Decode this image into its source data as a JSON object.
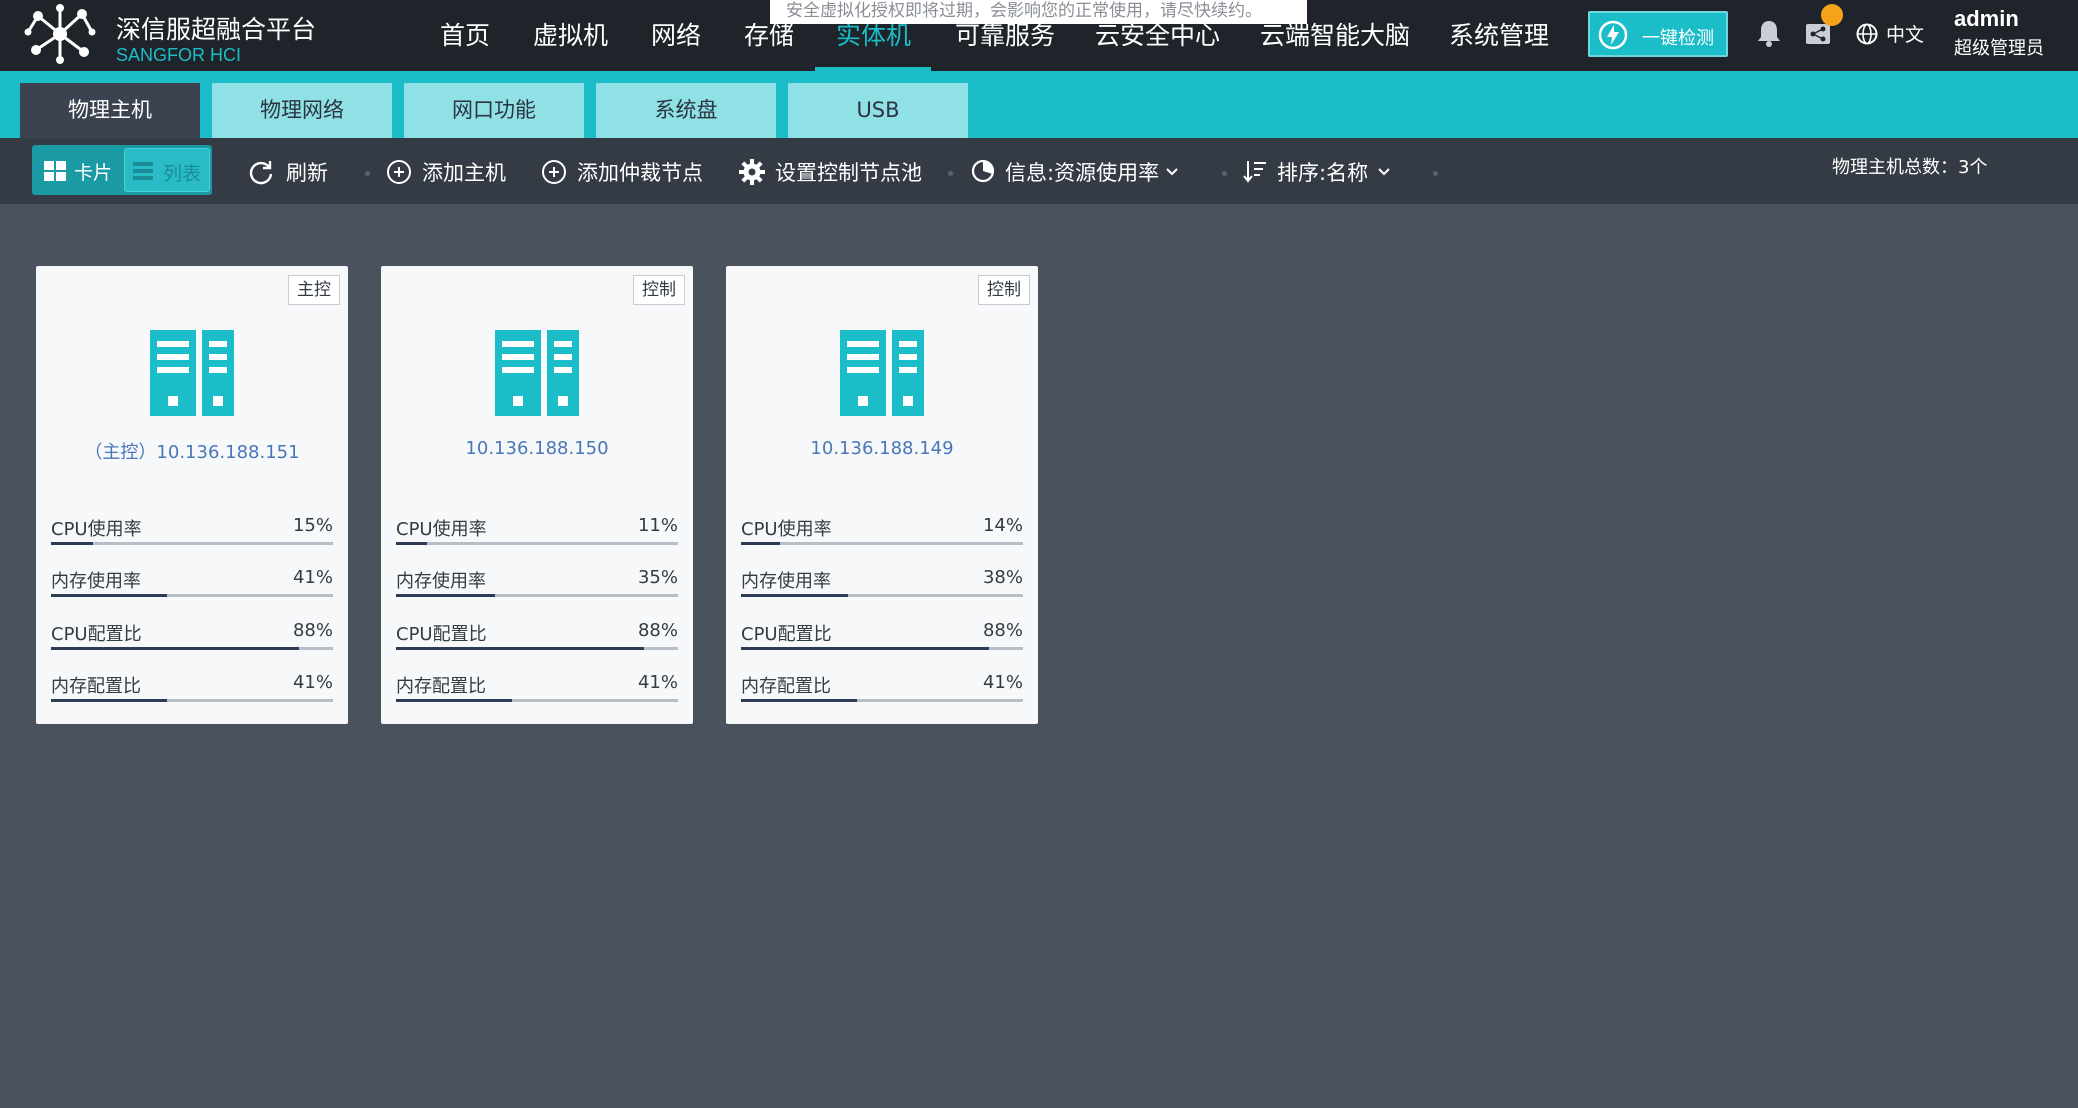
{
  "header": {
    "brand_cn": "深信服超融合平台",
    "brand_en": "SANGFOR HCI",
    "notice": "安全虚拟化授权即将过期，会影响您的正常使用，请尽快续约。",
    "nav": [
      "首页",
      "虚拟机",
      "网络",
      "存储",
      "实体机",
      "可靠服务",
      "云安全中心",
      "云端智能大脑",
      "系统管理"
    ],
    "active_nav_index": 4,
    "detect_button": "一键检测",
    "language": "中文",
    "user": {
      "name": "admin",
      "role": "超级管理员"
    },
    "badge_color": "#f7a21b"
  },
  "tabs": [
    "物理主机",
    "物理网络",
    "网口功能",
    "系统盘",
    "USB"
  ],
  "active_tab_index": 0,
  "toolbar": {
    "view_card": "卡片",
    "view_list": "列表",
    "refresh": "刷新",
    "add_host": "添加主机",
    "add_arbiter": "添加仲裁节点",
    "set_control_pool": "设置控制节点池",
    "info": "信息:资源使用率",
    "sort": "排序:名称",
    "total": "物理主机总数：3个"
  },
  "colors": {
    "accent": "#1bbec8",
    "header_bg": "#1f242b",
    "page_bg": "#4a525d",
    "link": "#4a76b8"
  },
  "hosts": [
    {
      "tag": "主控",
      "name": "（主控）10.136.188.151",
      "metrics": [
        {
          "label": "CPU使用率",
          "value": "15%",
          "percent": 15
        },
        {
          "label": "内存使用率",
          "value": "41%",
          "percent": 41
        },
        {
          "label": "CPU配置比",
          "value": "88%",
          "percent": 88
        },
        {
          "label": "内存配置比",
          "value": "41%",
          "percent": 41
        }
      ]
    },
    {
      "tag": "控制",
      "name": "10.136.188.150",
      "metrics": [
        {
          "label": "CPU使用率",
          "value": "11%",
          "percent": 11
        },
        {
          "label": "内存使用率",
          "value": "35%",
          "percent": 35
        },
        {
          "label": "CPU配置比",
          "value": "88%",
          "percent": 88
        },
        {
          "label": "内存配置比",
          "value": "41%",
          "percent": 41
        }
      ]
    },
    {
      "tag": "控制",
      "name": "10.136.188.149",
      "metrics": [
        {
          "label": "CPU使用率",
          "value": "14%",
          "percent": 14
        },
        {
          "label": "内存使用率",
          "value": "38%",
          "percent": 38
        },
        {
          "label": "CPU配置比",
          "value": "88%",
          "percent": 88
        },
        {
          "label": "内存配置比",
          "value": "41%",
          "percent": 41
        }
      ]
    }
  ]
}
